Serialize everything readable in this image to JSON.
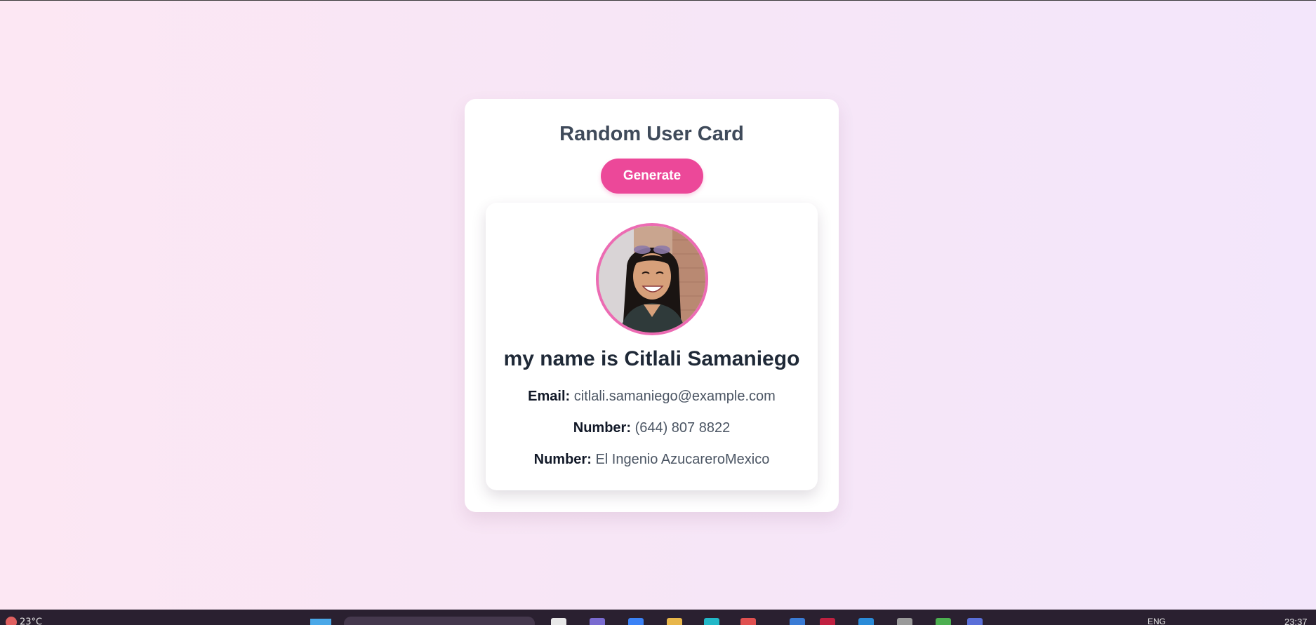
{
  "card": {
    "title": "Random User Card",
    "generate_label": "Generate"
  },
  "user": {
    "name": "my name is Citlali Samaniego",
    "fields": [
      {
        "label": "Email:",
        "value": "citlali.samaniego@example.com"
      },
      {
        "label": "Number:",
        "value": "(644) 807 8822"
      },
      {
        "label": "Number:",
        "value": "El Ingenio AzucareroMexico"
      }
    ],
    "avatar_icon": "user-photo"
  },
  "taskbar": {
    "weather": "23°C",
    "language": "ENG",
    "time": "23:37"
  },
  "colors": {
    "accent": "#ec4899",
    "avatar_border": "#ec6bb3",
    "title_text": "#3f4a5a",
    "name_text": "#1f2937"
  }
}
